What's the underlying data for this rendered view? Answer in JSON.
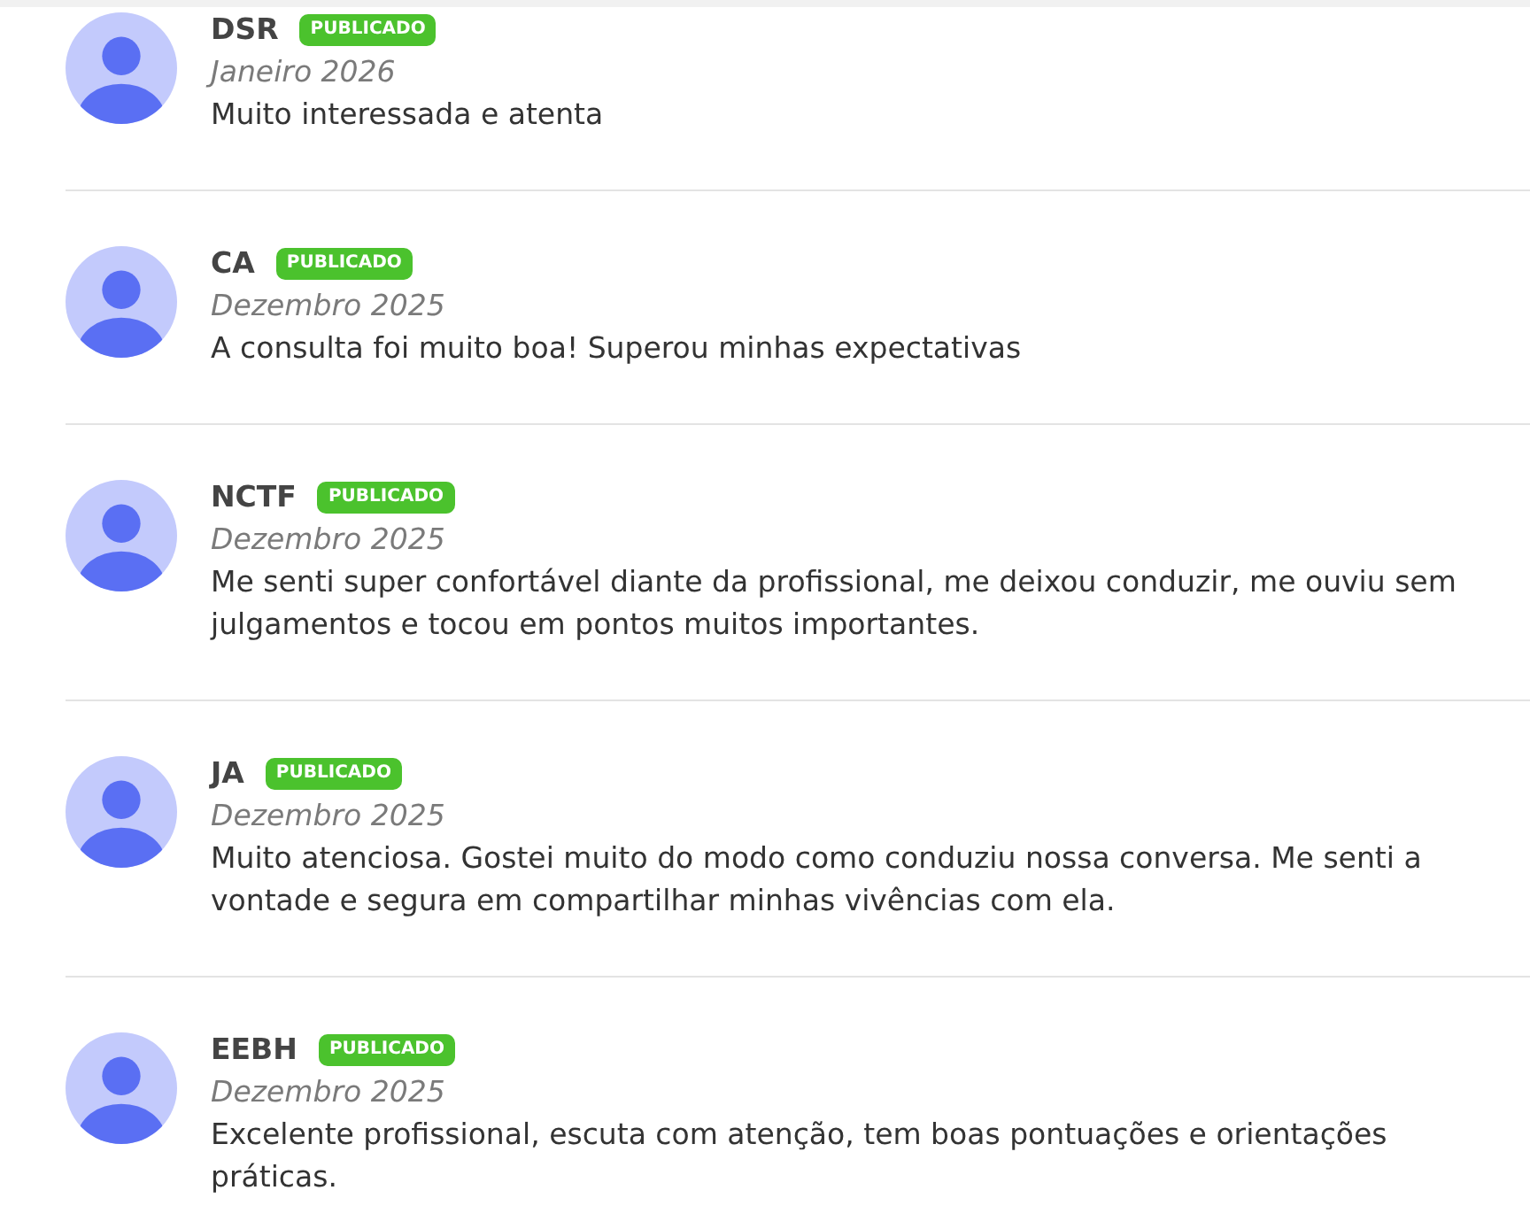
{
  "reviews": [
    {
      "author": "DSR",
      "status": "PUBLICADO",
      "date": "Janeiro 2026",
      "text": "Muito interessada e atenta"
    },
    {
      "author": "CA",
      "status": "PUBLICADO",
      "date": "Dezembro 2025",
      "text": "A consulta foi muito boa! Superou minhas expectativas"
    },
    {
      "author": "NCTF",
      "status": "PUBLICADO",
      "date": "Dezembro 2025",
      "text": "Me senti super confortável diante da profissional, me deixou conduzir, me ouviu sem julgamentos e tocou em pontos muitos importantes."
    },
    {
      "author": "JA",
      "status": "PUBLICADO",
      "date": "Dezembro 2025",
      "text": "Muito atenciosa. Gostei muito do modo como conduziu nossa conversa. Me senti a vontade e segura em compartilhar minhas vivências com ela."
    },
    {
      "author": "EEBH",
      "status": "PUBLICADO",
      "date": "Dezembro 2025",
      "text": "Excelente profissional, escuta com atenção, tem boas pontuações e orientações práticas."
    }
  ]
}
